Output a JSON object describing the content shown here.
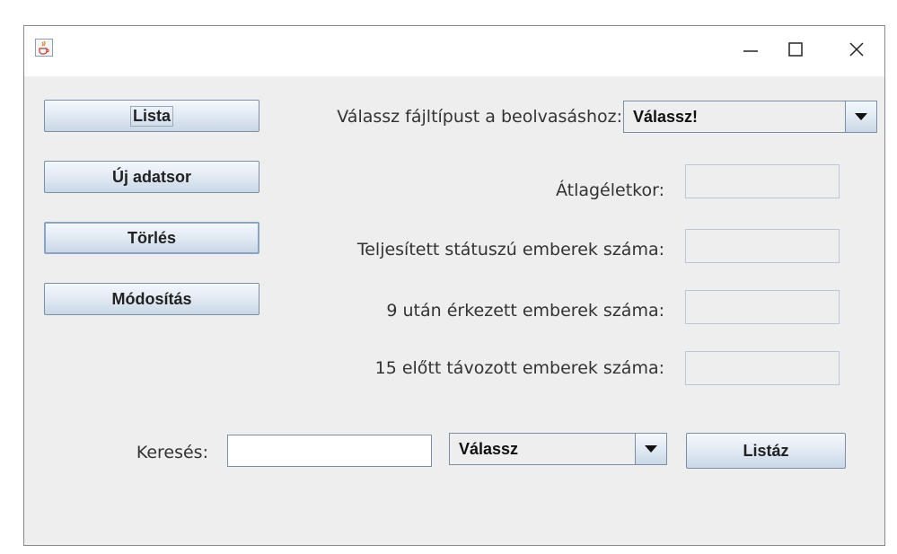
{
  "window": {
    "icon": "java-cup-icon",
    "controls": {
      "minimize": "—",
      "maximize": "☐",
      "close": "✕"
    }
  },
  "left_buttons": [
    {
      "label": "Lista"
    },
    {
      "label": "Új adatsor"
    },
    {
      "label": "Törlés"
    },
    {
      "label": "Módosítás"
    }
  ],
  "file_type": {
    "label": "Válassz fájltípust a beolvasáshoz:",
    "selected": "Válassz!"
  },
  "stats": [
    {
      "label": "Átlagéletkor:",
      "value": ""
    },
    {
      "label": "Teljesített státuszú emberek száma:",
      "value": ""
    },
    {
      "label": "9 után érkezett emberek száma:",
      "value": ""
    },
    {
      "label": "15 előtt távozott emberek száma:",
      "value": ""
    }
  ],
  "search": {
    "label": "Keresés:",
    "value": "",
    "filter_selected": "Válassz",
    "button_label": "Listáz"
  }
}
